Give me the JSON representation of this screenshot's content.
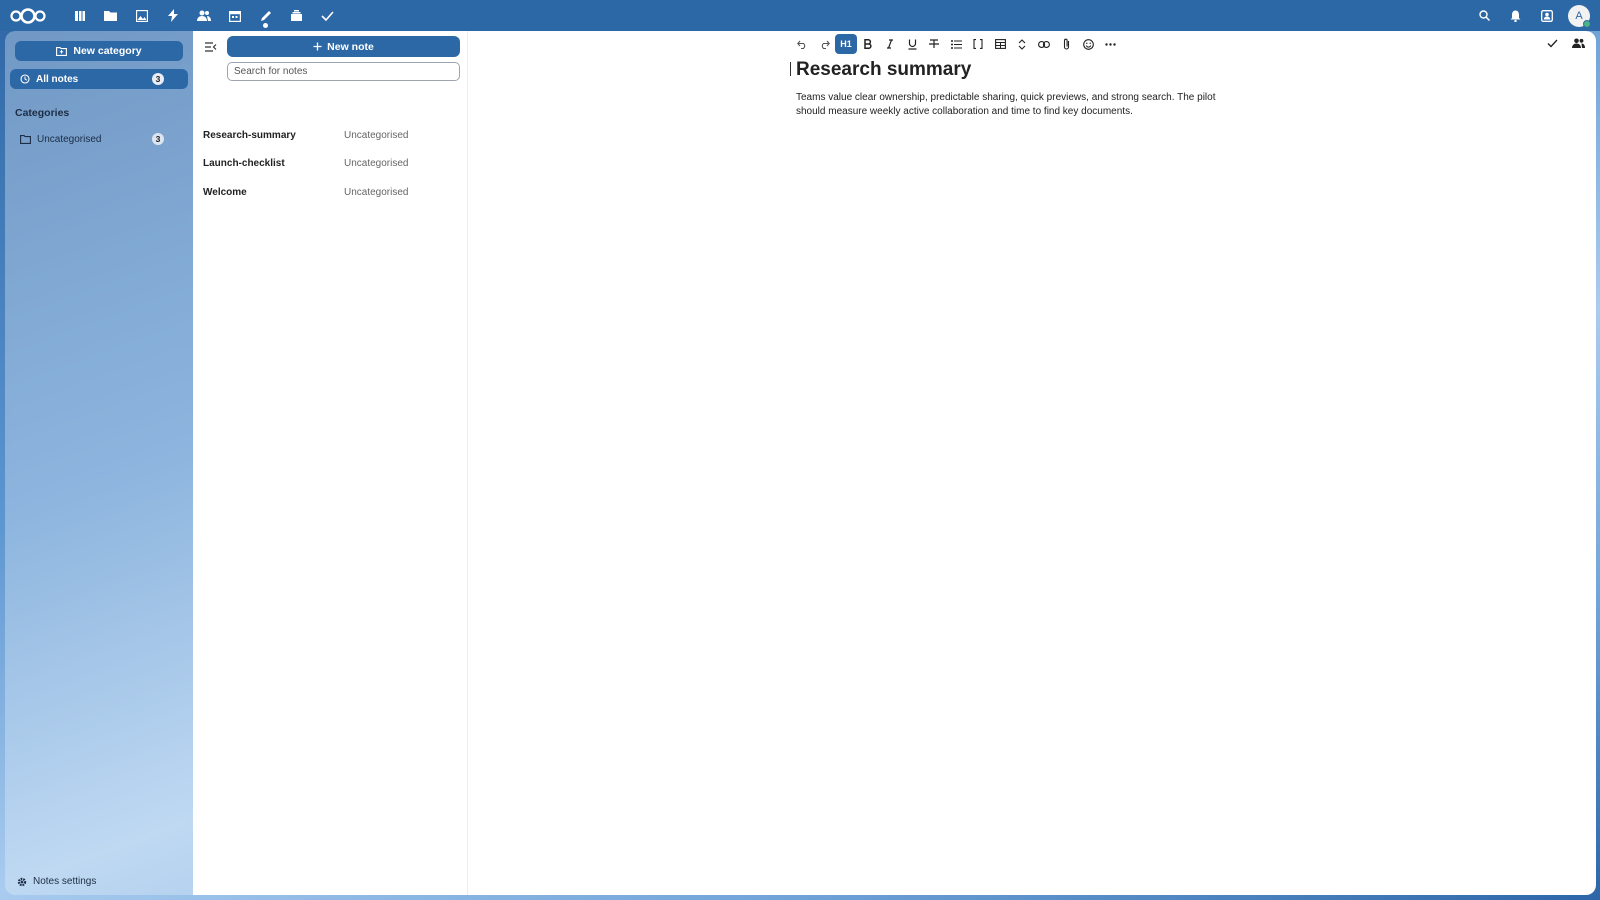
{
  "header": {
    "apps": [
      {
        "name": "dashboard-icon"
      },
      {
        "name": "files-icon"
      },
      {
        "name": "photos-icon"
      },
      {
        "name": "activity-icon"
      },
      {
        "name": "contacts-icon"
      },
      {
        "name": "calendar-icon"
      },
      {
        "name": "notes-icon",
        "active": true
      },
      {
        "name": "deck-icon"
      },
      {
        "name": "tasks-icon"
      }
    ],
    "user_initial": "A"
  },
  "sidebar": {
    "new_category_label": "New category",
    "all_notes_label": "All notes",
    "all_notes_count": "3",
    "categories_heading": "Categories",
    "categories": [
      {
        "label": "Uncategorised",
        "count": "3"
      }
    ],
    "settings_label": "Notes settings"
  },
  "notelist": {
    "new_note_label": "New note",
    "search_placeholder": "Search for notes",
    "notes": [
      {
        "title": "Research-summary",
        "category": "Uncategorised"
      },
      {
        "title": "Launch-checklist",
        "category": "Uncategorised"
      },
      {
        "title": "Welcome",
        "category": "Uncategorised"
      }
    ]
  },
  "editor": {
    "heading_button": "H1",
    "title": "Research summary",
    "body": "Teams value clear ownership, predictable sharing, quick previews, and strong search. The pilot should measure weekly active collaboration and time to find key documents."
  },
  "colors": {
    "primary": "#2d68a6",
    "online": "#49b382"
  }
}
